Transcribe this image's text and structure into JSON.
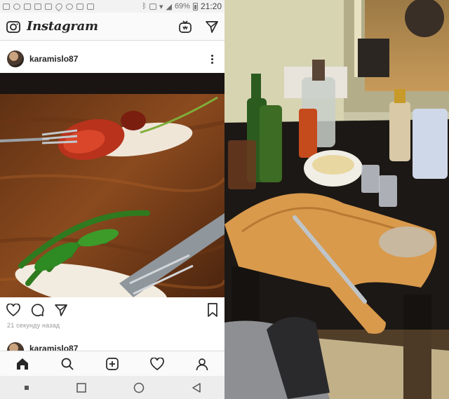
{
  "status_bar": {
    "battery": "69%",
    "time": "21:20"
  },
  "header": {
    "app_name": "Instagram"
  },
  "post": {
    "username": "karamislo87",
    "timestamp": "21 секунду назад"
  },
  "next_post": {
    "username": "karamislo87"
  },
  "bottom_nav": [
    "home-icon",
    "search-icon",
    "add-post-icon",
    "activity-heart-icon",
    "profile-icon"
  ],
  "android_nav": [
    "recents-square-icon",
    "home-circle-icon",
    "back-triangle-icon"
  ],
  "colors": {
    "text": "#262626",
    "divider": "#dbdbdb",
    "background": "#fafafa"
  }
}
